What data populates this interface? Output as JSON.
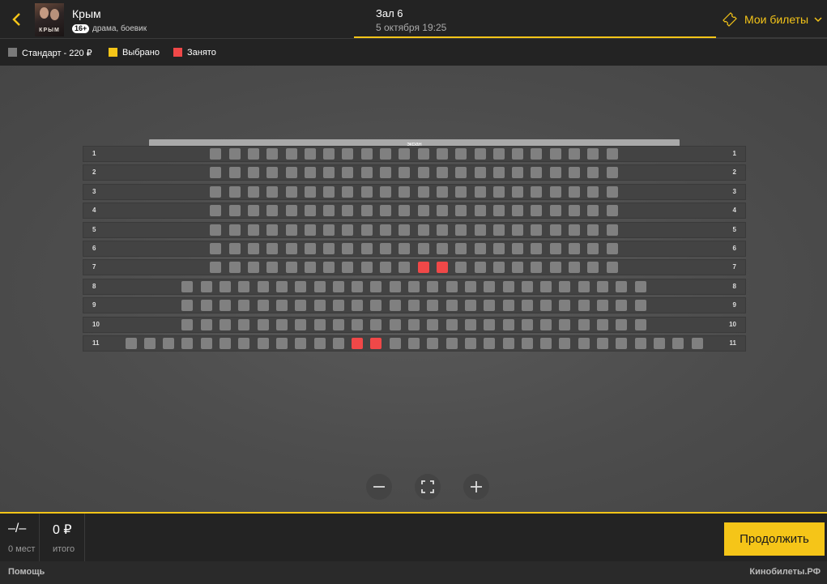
{
  "header": {
    "movie_title": "Крым",
    "age_rating": "16+",
    "genre": "драма, боевик",
    "poster_text": "КРЫМ",
    "hall": "Зал 6",
    "datetime": "5 октября 19:25",
    "my_tickets_label": "Мои билеты",
    "accent_color": "#f5c518"
  },
  "legend": [
    {
      "label": "Стандарт - 220 ₽",
      "color": "#7a7a7a"
    },
    {
      "label": "Выбрано",
      "color": "#f5c518"
    },
    {
      "label": "Занято",
      "color": "#f04848"
    }
  ],
  "hall_map": {
    "screen_label": "экран",
    "seat_colors": {
      "free": "#808080",
      "selected": "#f5c518",
      "occupied": "#f04848"
    },
    "rows": [
      {
        "number": "1",
        "seats": 22,
        "occupied": []
      },
      {
        "number": "2",
        "seats": 22,
        "occupied": []
      },
      {
        "number": "3",
        "seats": 22,
        "occupied": []
      },
      {
        "number": "4",
        "seats": 22,
        "occupied": []
      },
      {
        "number": "5",
        "seats": 22,
        "occupied": []
      },
      {
        "number": "6",
        "seats": 22,
        "occupied": []
      },
      {
        "number": "7",
        "seats": 22,
        "occupied": [
          12,
          13
        ]
      },
      {
        "number": "8",
        "seats": 25,
        "occupied": []
      },
      {
        "number": "9",
        "seats": 25,
        "occupied": []
      },
      {
        "number": "10",
        "seats": 25,
        "occupied": []
      },
      {
        "number": "11",
        "seats": 31,
        "occupied": [
          13,
          14
        ]
      }
    ]
  },
  "zoom_controls": [
    "zoom-out",
    "fit",
    "zoom-in"
  ],
  "footer": {
    "seats_value": "–/–",
    "seats_label": "0 мест",
    "total_value": "0 ₽",
    "total_label": "итого",
    "continue_label": "Продолжить"
  },
  "bottom_bar": {
    "help_label": "Помощь",
    "brand": "Кинобилеты.РФ"
  }
}
